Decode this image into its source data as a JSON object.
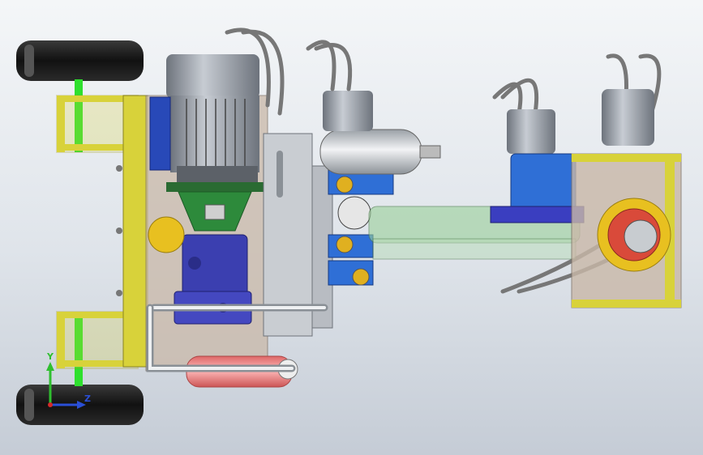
{
  "viewport": {
    "background": [
      "#f4f6f8",
      "#c5ccd6"
    ]
  },
  "triad": {
    "y_label": "Y",
    "z_label": "Z",
    "y_color": "#2fbf2f",
    "z_color": "#2a4fd6",
    "x_color": "#d42a2a"
  },
  "colors": {
    "yellow_frame": "#d8d23a",
    "green_axle": "#2ee02e",
    "motor_grey": "#9aa0a8",
    "pump_blue": "#3b3fb0",
    "valve_blue": "#2f6fd6",
    "accumulator_red": "#f08a8a",
    "gear_red": "#d94a3a",
    "tank_beige": "#c9b8a8"
  }
}
